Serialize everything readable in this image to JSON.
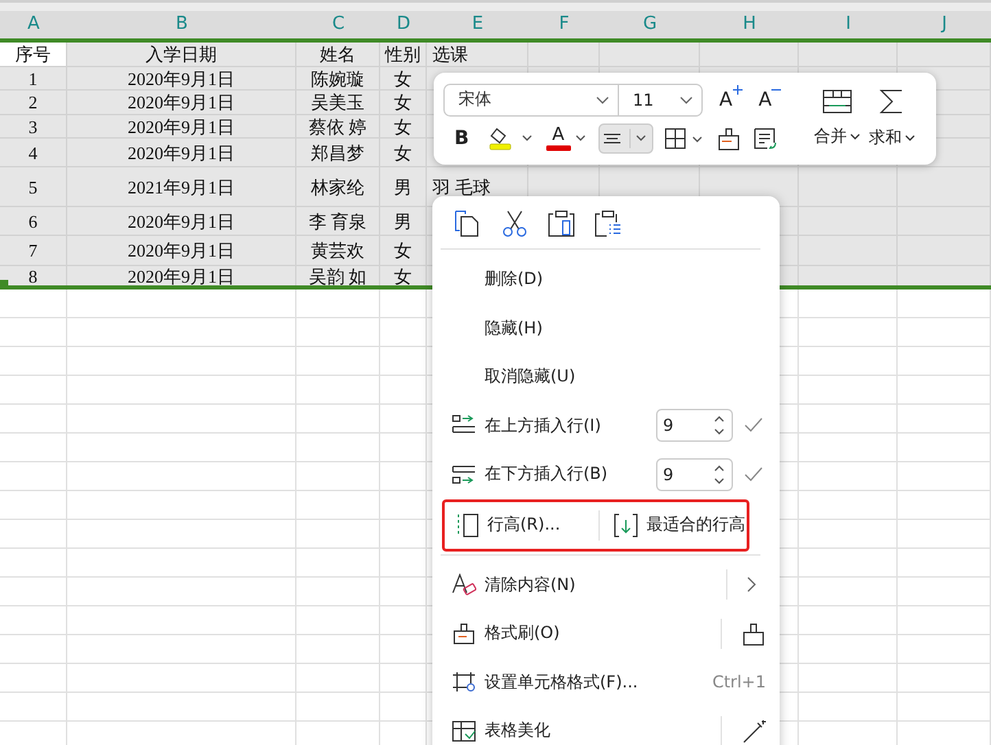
{
  "columns": [
    "A",
    "B",
    "C",
    "D",
    "E",
    "F",
    "G",
    "H",
    "I",
    "J"
  ],
  "header_row": {
    "selected": true,
    "cells": [
      {
        "text": "序号",
        "selected": true
      },
      {
        "text": "入学日期",
        "selected": false
      },
      {
        "text": "姓名",
        "selected": false
      },
      {
        "text": "性别",
        "selected": false
      },
      {
        "text": "选课",
        "selected": false
      }
    ]
  },
  "rows": [
    {
      "selected": true,
      "cells": [
        "1",
        "2020年9月1日",
        "陈婉璇",
        "女"
      ]
    },
    {
      "selected": true,
      "cells": [
        "2",
        "2020年9月1日",
        "吴美玉",
        "女"
      ]
    },
    {
      "selected": true,
      "cells": [
        "3",
        "2020年9月1日",
        "蔡依 婷",
        "女"
      ]
    },
    {
      "selected": true,
      "cells": [
        "4",
        "2020年9月1日",
        "郑昌梦",
        "女"
      ]
    },
    {
      "selected": true,
      "cells": [
        "5",
        "2021年9月1日",
        "林家纶",
        "男",
        "羽 毛球"
      ]
    },
    {
      "selected": true,
      "cells": [
        "6",
        "2020年9月1日",
        "李 育泉",
        "男"
      ]
    },
    {
      "selected": true,
      "cells": [
        "7",
        "2020年9月1日",
        "黄芸欢",
        "女"
      ]
    },
    {
      "selected": true,
      "cells": [
        "8",
        "2020年9月1日",
        "吴韵 如",
        "女"
      ]
    }
  ],
  "toolbar": {
    "font": "宋体",
    "size": "11",
    "grow_label": "A",
    "shrink_label": "A",
    "buttons": [
      {
        "kind": "bold",
        "label": "B"
      },
      {
        "kind": "highlight"
      },
      {
        "kind": "font_color",
        "label": "A"
      },
      {
        "kind": "align",
        "selected": true
      },
      {
        "kind": "borders"
      },
      {
        "kind": "clear_format"
      },
      {
        "kind": "wrap"
      }
    ],
    "merge_label": "合并",
    "sum_label": "求和"
  },
  "menu": {
    "items": [
      {
        "kind": "plain",
        "label": "删除(D)"
      },
      {
        "kind": "plain",
        "label": "隐藏(H)"
      },
      {
        "kind": "plain",
        "label": "取消隐藏(U)"
      },
      {
        "kind": "spinner",
        "label": "在上方插入行(I)",
        "value": "9"
      },
      {
        "kind": "spinner",
        "label": "在下方插入行(B)",
        "value": "9"
      },
      {
        "kind": "split",
        "label": "行高(R)...",
        "second_label": "最适合的行高",
        "highlighted": true
      },
      {
        "kind": "separator"
      },
      {
        "kind": "submenu",
        "label": "清除内容(N)"
      },
      {
        "kind": "tool",
        "label": "格式刷(O)"
      },
      {
        "kind": "shortcut",
        "label": "设置单元格格式(F)...",
        "shortcut": "Ctrl+1"
      },
      {
        "kind": "tool",
        "label": "表格美化"
      }
    ]
  }
}
